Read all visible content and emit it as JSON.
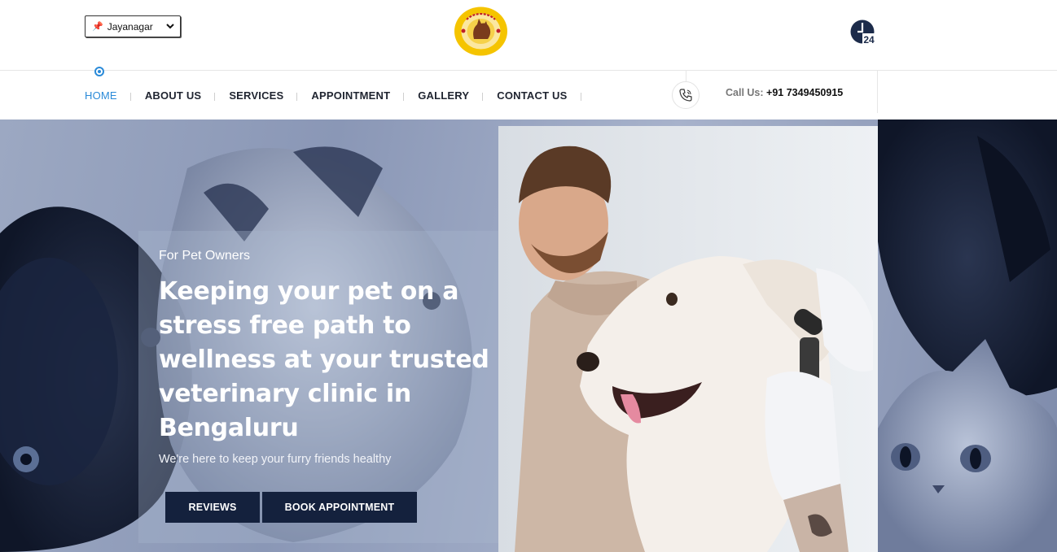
{
  "header": {
    "location": {
      "selected": "Jayanagar",
      "pin_color": "#d9254a"
    },
    "logo": {
      "text": "PAPA'S LIFE LINE",
      "colors": {
        "ring": "#f5c400",
        "text": "#c0202a",
        "dog": "#7a3b1c"
      }
    },
    "badge": {
      "label": "24",
      "color": "#1c2b4a"
    }
  },
  "nav": {
    "items": [
      {
        "label": "HOME",
        "active": true
      },
      {
        "label": "ABOUT US"
      },
      {
        "label": "SERVICES"
      },
      {
        "label": "APPOINTMENT"
      },
      {
        "label": "GALLERY"
      },
      {
        "label": "CONTACT US"
      }
    ],
    "active_color": "#2a8ad8",
    "call": {
      "prefix": "Call Us:",
      "number": "+91 7349450915"
    }
  },
  "hero": {
    "eyebrow": "For Pet Owners",
    "headline": "Keeping your pet on a stress free path to wellness at your trusted veterinary clinic in Bengaluru",
    "subline": "We're here to keep your furry friends healthy",
    "buttons": {
      "reviews": "REVIEWS",
      "book": "BOOK APPOINTMENT"
    },
    "button_color": "#14213d"
  },
  "icons": {
    "location_pin": "pin-icon",
    "dropdown": "chevron-down-icon",
    "phone": "phone-icon",
    "badge": "24-hours-icon"
  }
}
